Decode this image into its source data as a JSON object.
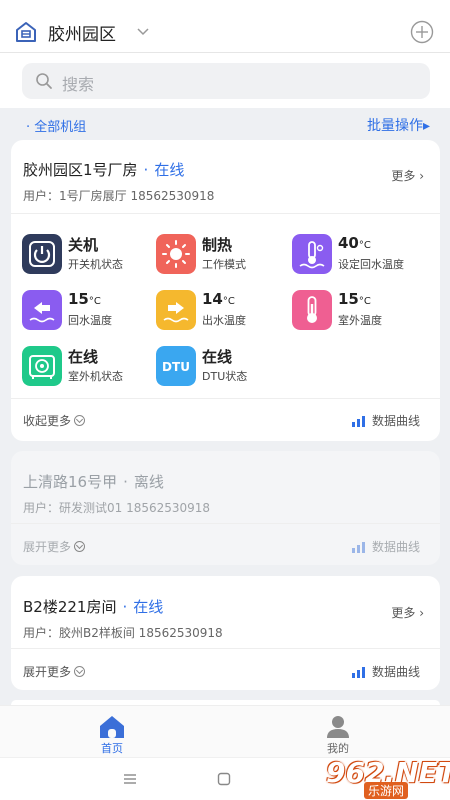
{
  "header": {
    "park_name": "胶州园区",
    "search_placeholder": "搜索"
  },
  "toolbar": {
    "group_label": "· 全部机组",
    "batch_label": "批量操作▸"
  },
  "cards": [
    {
      "name": "胶州园区1号厂房",
      "dot": "·",
      "status": "在线",
      "user": "用户：1号厂房展厅 18562530918",
      "more": "更多",
      "metrics": [
        {
          "value": "关机",
          "unit": "",
          "label": "开关机状态",
          "icon": "power-icon",
          "color": "#2f3b5c"
        },
        {
          "value": "制热",
          "unit": "",
          "label": "工作模式",
          "icon": "sun-icon",
          "color": "#f0645a"
        },
        {
          "value": "40",
          "unit": "°C",
          "label": "设定回水温度",
          "icon": "set-temp-icon",
          "color": "#8a5cf0"
        },
        {
          "value": "15",
          "unit": "°C",
          "label": "回水温度",
          "icon": "return-water-icon",
          "color": "#8a5cf0"
        },
        {
          "value": "14",
          "unit": "°C",
          "label": "出水温度",
          "icon": "outlet-water-icon",
          "color": "#f5b82e"
        },
        {
          "value": "15",
          "unit": "°C",
          "label": "室外温度",
          "icon": "thermometer-icon",
          "color": "#ef5f92"
        },
        {
          "value": "在线",
          "unit": "",
          "label": "室外机状态",
          "icon": "outdoor-unit-icon",
          "color": "#1fc98a"
        },
        {
          "value": "在线",
          "unit": "",
          "label": "DTU状态",
          "icon": "dtu-icon",
          "color": "#3aa7f0"
        }
      ],
      "collapse": "收起更多",
      "chart_link": "数据曲线"
    },
    {
      "name": "上清路16号甲",
      "dot": "·",
      "status": "离线",
      "user": "用户：研发测试01 18562530918",
      "expand": "展开更多",
      "chart_link": "数据曲线"
    },
    {
      "name": "B2楼221房间",
      "dot": "·",
      "status": "在线",
      "user": "用户：胶州B2样板间 18562530918",
      "more": "更多",
      "expand": "展开更多",
      "chart_link": "数据曲线"
    }
  ],
  "tabs": [
    {
      "label": "首页",
      "active": true
    },
    {
      "label": "我的",
      "active": false
    }
  ],
  "dtu_text": "DTU",
  "watermark": {
    "main": "962.NET",
    "sub": "乐游网"
  },
  "colors": {
    "accent": "#2f6fe6"
  }
}
